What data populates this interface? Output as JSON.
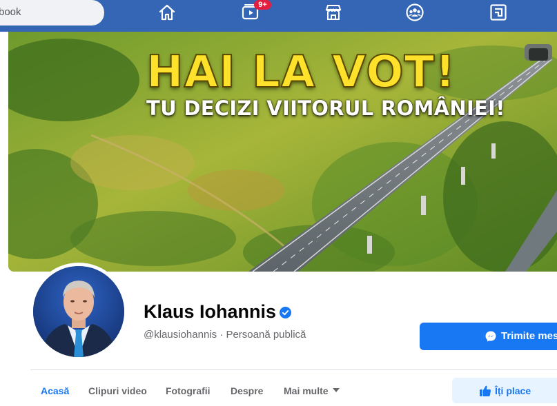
{
  "topbar": {
    "search_text": "book",
    "watch_badge": "9+",
    "icons": [
      "home-icon",
      "watch-icon",
      "marketplace-icon",
      "groups-icon",
      "gaming-icon"
    ]
  },
  "cover": {
    "headline": "HAI LA VOT!",
    "subheadline": "TU DECIZI VIITORUL ROMÂNIEI!"
  },
  "profile": {
    "name": "Klaus Iohannis",
    "verified": true,
    "subtitle": "@klausiohannis · Persoană publică"
  },
  "actions": {
    "message_label": "Trimite mes",
    "like_label": "Îți place"
  },
  "tabs": [
    {
      "label": "Acasă",
      "active": true
    },
    {
      "label": "Clipuri video",
      "active": false
    },
    {
      "label": "Fotografii",
      "active": false
    },
    {
      "label": "Despre",
      "active": false
    },
    {
      "label": "Mai multe",
      "active": false
    }
  ],
  "colors": {
    "topbar": "#3466b5",
    "accent": "#1877f2",
    "headline": "#fde12a",
    "badge": "#e41e3f"
  }
}
